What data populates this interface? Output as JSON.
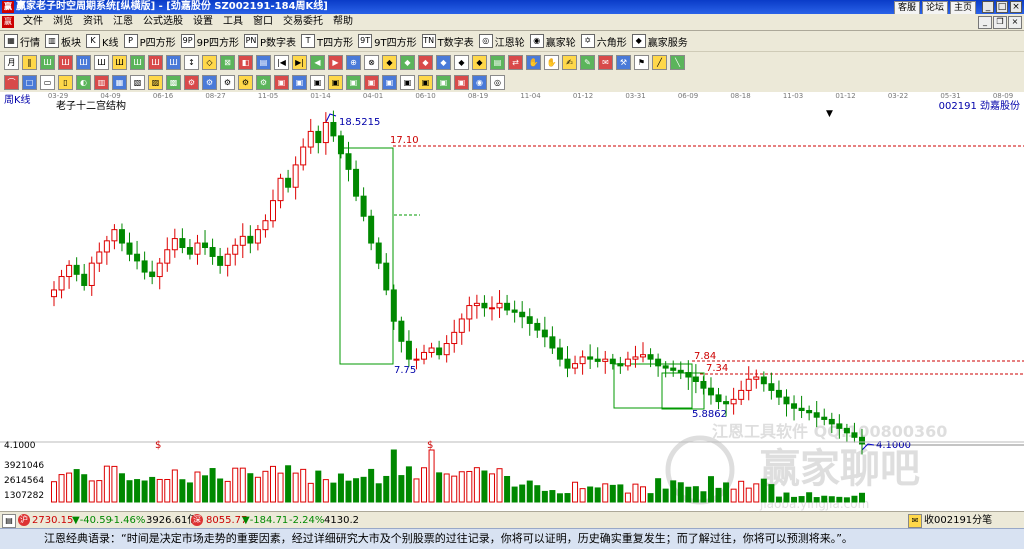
{
  "window": {
    "app_icon": "赢",
    "title": "赢家老子时空周期系统[纵横版] - [劲嘉股份  SZ002191-184周K线]",
    "links": [
      "客服",
      "论坛",
      "主页"
    ],
    "controls": [
      "_",
      "□",
      "×"
    ]
  },
  "menu": {
    "logo": "赢",
    "items": [
      "文件",
      "浏览",
      "资讯",
      "江恩",
      "公式选股",
      "设置",
      "工具",
      "窗口",
      "交易委托",
      "帮助"
    ]
  },
  "toolbar1": [
    {
      "icon": "▦",
      "label": "行情"
    },
    {
      "icon": "▥",
      "label": "板块"
    },
    {
      "icon": "K",
      "label": "K线"
    },
    {
      "icon": "P",
      "label": "P四方形"
    },
    {
      "icon": "9P",
      "label": "9P四方形"
    },
    {
      "icon": "PN",
      "label": "P数字表"
    },
    {
      "icon": "T",
      "label": "T四方形"
    },
    {
      "icon": "9T",
      "label": "9T四方形"
    },
    {
      "icon": "TN",
      "label": "T数字表"
    },
    {
      "icon": "◎",
      "label": "江恩轮"
    },
    {
      "icon": "◉",
      "label": "赢家轮"
    },
    {
      "icon": "✡",
      "label": "六角形"
    },
    {
      "icon": "◆",
      "label": "赢家服务"
    }
  ],
  "toolbar2_icons": [
    "月",
    "‖",
    "Ш",
    "Ш",
    "Ш",
    "Ш",
    "Ш",
    "Ш",
    "Ш",
    "Ш",
    "↕",
    "◇",
    "⊠",
    "◧",
    "▤",
    "|◀",
    "▶|",
    "◀",
    "▶",
    "⊕",
    "⊗",
    "◆",
    "◆",
    "◆",
    "◆",
    "◆",
    "◆",
    "▤",
    "⇄",
    "✋",
    "✋",
    "✍",
    "✎",
    "✉",
    "⚒",
    "⚑",
    "╱",
    "╲",
    "⌒",
    "□",
    "▭",
    "▯",
    "◐",
    "▥",
    "▦",
    "▧",
    "▨",
    "▩",
    "⚙",
    "⚙",
    "⚙",
    "⚙",
    "⚙",
    "▣",
    "▣",
    "▣",
    "▣",
    "▣",
    "▣",
    "▣",
    "▣",
    "▣",
    "▣",
    "▣",
    "◉",
    "◎"
  ],
  "chart": {
    "period_label": "周K线",
    "indicator_label": "老子十二宫结构",
    "stock_code_name": "002191  劲嘉股份",
    "date_ticks": [
      "03-29",
      "04-09",
      "06-16",
      "08-27",
      "11-05",
      "01-14",
      "04-01",
      "06-10",
      "08-19",
      "11-04",
      "01-12",
      "03-31",
      "06-09",
      "08-18",
      "11-03",
      "01-12",
      "03-22",
      "05-31",
      "08-09"
    ],
    "price_labels": {
      "peak": "18.5215",
      "level_top": "17.10",
      "box_low": "7.75",
      "level_mid1": "7.84",
      "level_mid2": "7.34",
      "low2": "5.8862",
      "low_last": "4.1000"
    },
    "volume_axis": [
      "4.1000",
      "3921046",
      "2614564",
      "1307282"
    ],
    "volume_markers": [
      "$",
      "$"
    ],
    "watermark_lines": [
      "江恩工具软件  QQ:100800360",
      "赢家聊吧",
      "jiaoba.yingjia.com"
    ]
  },
  "chart_data": {
    "type": "candlestick",
    "series": [
      {
        "name": "",
        "values": [
          11.0,
          11.6,
          12.1,
          11.7,
          11.2,
          12.2,
          12.7,
          13.2,
          13.7,
          13.1,
          12.6,
          12.3,
          11.8,
          11.6,
          12.2,
          12.8,
          13.3,
          12.9,
          12.6,
          13.1,
          12.9,
          12.5,
          12.1,
          12.6,
          13.0,
          13.4,
          13.1,
          13.7,
          14.1,
          15.0,
          16.0,
          15.6,
          16.6,
          17.4,
          18.1,
          17.6,
          18.5,
          17.9,
          17.1,
          16.4,
          15.2,
          14.3,
          13.1,
          12.2,
          11.0,
          9.6,
          8.7,
          7.9,
          7.9,
          8.2,
          8.4,
          8.1,
          8.6,
          9.1,
          9.7,
          10.3,
          10.4,
          10.2,
          10.2,
          10.4,
          10.1,
          10.0,
          9.8,
          9.5,
          9.2,
          8.9,
          8.4,
          7.9,
          7.5,
          7.7,
          8.0,
          7.9,
          7.8,
          7.9,
          7.7,
          7.6,
          7.9,
          8.0,
          8.1,
          7.9,
          7.6,
          7.5,
          7.4,
          7.3,
          7.1,
          6.9,
          6.6,
          6.3,
          6.0,
          5.9,
          6.1,
          6.5,
          7.0,
          7.1,
          6.8,
          6.5,
          6.2,
          5.9,
          5.7,
          5.6,
          5.5,
          5.3,
          5.2,
          5.0,
          4.8,
          4.6,
          4.4,
          4.1
        ]
      }
    ],
    "ylim": [
      4.1,
      18.5215
    ],
    "xlabel": "",
    "ylabel": "",
    "volume_ylim": [
      0,
      3921046
    ],
    "volume_ticks": [
      1307282,
      2614564,
      3921046
    ],
    "markers": [
      {
        "price": 18.5215,
        "label": "18.5215"
      },
      {
        "price": 17.1,
        "label": "17.10"
      },
      {
        "price": 7.75,
        "label": "7.75"
      },
      {
        "price": 7.84,
        "label": "7.84"
      },
      {
        "price": 7.34,
        "label": "7.34"
      },
      {
        "price": 5.8862,
        "label": "5.8862"
      },
      {
        "price": 4.1,
        "label": "4.1000"
      }
    ],
    "grid": false
  },
  "status": {
    "sh_index": "2730.15",
    "sh_change": "▼-40.59",
    "sh_pct": "-1.46%",
    "sh_vol": "3926.61亿",
    "sz_index": "8055.77",
    "sz_change": "▼-184.71",
    "sz_pct": "-2.24%",
    "sz_vol": "4130.2",
    "right_text": "收002191分笔"
  },
  "quote": "江恩经典语录：“时间是决定市场走势的重要因素，经过详细研究大市及个别股票的过往记录，你将可以证明，历史确实重复发生；而了解过往，你将可以预测将来。”。"
}
